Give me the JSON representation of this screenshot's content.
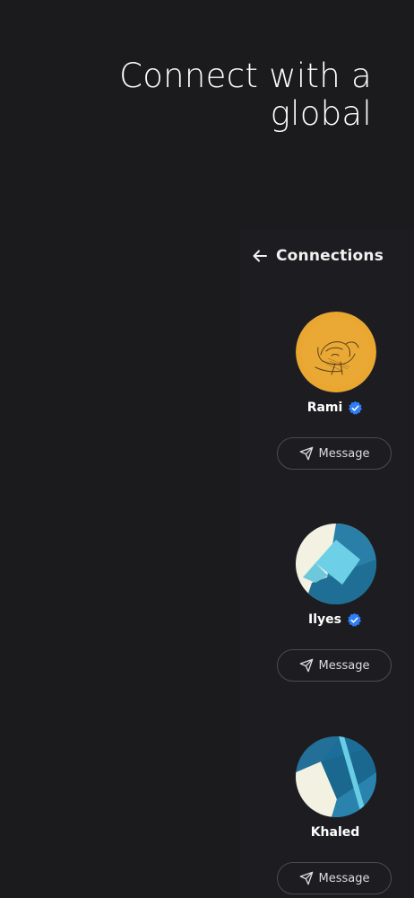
{
  "hero": {
    "line1": "Connect with a",
    "line2": "global"
  },
  "header": {
    "back_icon": "arrow-left-icon",
    "title": "Connections"
  },
  "connections": [
    {
      "name": "Rami",
      "verified": true,
      "avatar": "sketch-portrait-on-orange",
      "button_label": "Message",
      "button_icon": "send-icon"
    },
    {
      "name": "Ilyes",
      "verified": true,
      "avatar": "geometric-blue-cream",
      "button_label": "Message",
      "button_icon": "send-icon"
    },
    {
      "name": "Khaled",
      "verified": false,
      "avatar": "geometric-blue-diagonal",
      "button_label": "Message",
      "button_icon": "send-icon"
    }
  ],
  "colors": {
    "background": "#1b1b1e",
    "verified_badge": "#2f7ef5",
    "button_border": "#4a4a50",
    "avatar_orange": "#e9a630",
    "avatar_blue": "#2a7fa8",
    "avatar_cream": "#f2f1e2"
  }
}
